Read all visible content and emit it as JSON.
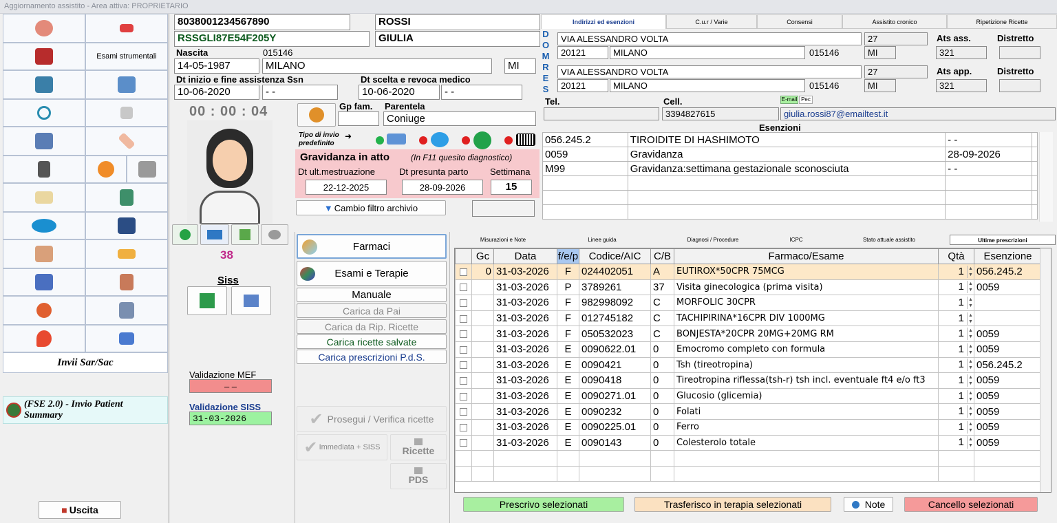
{
  "window_title": "Aggiornamento assistito - Area attiva: PROPRIETARIO",
  "patient": {
    "card_number": "8038001234567890",
    "fiscal_code": "RSSGLI87E54F205Y",
    "surname": "ROSSI",
    "name": "GIULIA",
    "birth_label": "Nascita",
    "birth_code": "015146",
    "birth_date": "14-05-1987",
    "birth_city": "MILANO",
    "birth_prov": "MI",
    "ssn_label": "Dt inizio e fine assistenza Ssn",
    "ssn_start": "10-06-2020",
    "ssn_end": "- -",
    "doctor_label": "Dt scelta e revoca medico",
    "doctor_start": "10-06-2020",
    "doctor_end": "- -",
    "timer": "00 : 00 : 04",
    "gp_label": "Gp fam.",
    "gp_value": "",
    "relation_label": "Parentela",
    "relation_value": "Coniuge",
    "count": "38",
    "siss_label": "Siss"
  },
  "send_type": {
    "label": "Tipo di invio predefinito",
    "arrow": "➜"
  },
  "pregnancy": {
    "title": "Gravidanza in atto",
    "note": "(In F11 quesito diagnostico)",
    "lmp_label": "Dt ult.mestruazione",
    "lmp": "22-12-2025",
    "due_label": "Dt presunta parto",
    "due": "28-09-2026",
    "week_label": "Settimana",
    "week": "15"
  },
  "filter_button": "Cambio filtro archivio",
  "validation": {
    "mef_label": "Validazione MEF",
    "mef_value": "–   –",
    "siss_label": "Validazione SISS",
    "siss_value": "31-03-2026"
  },
  "nav": {
    "esami_label": "Esami strumentali",
    "invii_label": "Invii Sar/Sac",
    "fse_label": "(FSE 2.0) - Invio Patient Summary",
    "exit_label": "Uscita"
  },
  "top_tabs": [
    "Indirizzi ed esenzioni",
    "C.u.r / Varie",
    "Consensi",
    "Assistito cronico",
    "Ripetizione Ricette"
  ],
  "address": {
    "dom_letters": [
      "D",
      "O",
      "M"
    ],
    "res_letters": [
      "R",
      "E",
      "S"
    ],
    "dom_street": "VIA ALESSANDRO VOLTA",
    "dom_number": "27",
    "dom_cap": "20121",
    "dom_city": "MILANO",
    "dom_code": "015146",
    "dom_prov": "MI",
    "ats_ass_label": "Ats ass.",
    "ats_ass": "321",
    "distretto_label": "Distretto",
    "res_street": "VIA ALESSANDRO VOLTA",
    "res_number": "27",
    "res_cap": "20121",
    "res_city": "MILANO",
    "res_code": "015146",
    "res_prov": "MI",
    "ats_app_label": "Ats app.",
    "ats_app": "321",
    "tel_label": "Tel.",
    "tel": "",
    "cell_label": "Cell.",
    "cell": "3394827615",
    "email_tag": "E-mail",
    "pec_tag": "Pec",
    "email": "giulia.rossi87@emailtest.it"
  },
  "exemptions": {
    "title": "Esenzioni",
    "rows": [
      {
        "code": "056.245.2",
        "desc": "TIROIDITE DI HASHIMOTO",
        "date": "- -"
      },
      {
        "code": "0059",
        "desc": "Gravidanza",
        "date": "28-09-2026"
      },
      {
        "code": "M99",
        "desc": "Gravidanza:settimana gestazionale sconosciuta",
        "date": "- -"
      }
    ]
  },
  "mid_buttons": {
    "farmaci": "Farmaci",
    "esami": "Esami e Terapie",
    "manuale": "Manuale",
    "carica_pai": "Carica da Pai",
    "carica_rip": "Carica da Rip. Ricette",
    "carica_salvate": "Carica ricette salvate",
    "carica_pds": "Carica prescrizioni P.d.S.",
    "prosegui": "Prosegui / Verifica ricette",
    "immediata": "Immediata + SISS",
    "ricette": "Ricette",
    "pds": "PDS"
  },
  "lower_tabs": [
    "Misurazioni e Note",
    "Linee guida",
    "Diagnosi / Procedure",
    "ICPC",
    "Stato attuale assistito",
    "Ultime prescrizioni"
  ],
  "prescriptions": {
    "headers": [
      "",
      "Gc",
      "Data",
      "f/e/p",
      "Codice/AIC",
      "C/B",
      "Farmaco/Esame",
      "Qtà",
      "Esenzione"
    ],
    "rows": [
      {
        "gc": "0",
        "date": "31-03-2026",
        "type": "F",
        "code": "024402051",
        "cb": "A",
        "name": "EUTIROX*50CPR 75MCG",
        "qty": "1",
        "ex": "056.245.2"
      },
      {
        "gc": "",
        "date": "31-03-2026",
        "type": "P",
        "code": "3789261",
        "cb": "37",
        "name": "Visita ginecologica (prima visita)",
        "qty": "1",
        "ex": "0059"
      },
      {
        "gc": "",
        "date": "31-03-2026",
        "type": "F",
        "code": "982998092",
        "cb": "C",
        "name": "MORFOLIC 30CPR",
        "qty": "1",
        "ex": ""
      },
      {
        "gc": "",
        "date": "31-03-2026",
        "type": "F",
        "code": "012745182",
        "cb": "C",
        "name": "TACHIPIRINA*16CPR DIV 1000MG",
        "qty": "1",
        "ex": ""
      },
      {
        "gc": "",
        "date": "31-03-2026",
        "type": "F",
        "code": "050532023",
        "cb": "C",
        "name": "BONJESTA*20CPR 20MG+20MG RM",
        "qty": "1",
        "ex": "0059"
      },
      {
        "gc": "",
        "date": "31-03-2026",
        "type": "E",
        "code": "0090622.01",
        "cb": "0",
        "name": "Emocromo completo con formula",
        "qty": "1",
        "ex": "0059"
      },
      {
        "gc": "",
        "date": "31-03-2026",
        "type": "E",
        "code": "0090421",
        "cb": "0",
        "name": "Tsh (tireotropina)",
        "qty": "1",
        "ex": "056.245.2"
      },
      {
        "gc": "",
        "date": "31-03-2026",
        "type": "E",
        "code": "0090418",
        "cb": "0",
        "name": "Tireotropina riflessa(tsh-r) tsh incl. eventuale ft4 e/o ft3",
        "qty": "1",
        "ex": "0059"
      },
      {
        "gc": "",
        "date": "31-03-2026",
        "type": "E",
        "code": "0090271.01",
        "cb": "0",
        "name": "Glucosio (glicemia)",
        "qty": "1",
        "ex": "0059"
      },
      {
        "gc": "",
        "date": "31-03-2026",
        "type": "E",
        "code": "0090232",
        "cb": "0",
        "name": "Folati",
        "qty": "1",
        "ex": "0059"
      },
      {
        "gc": "",
        "date": "31-03-2026",
        "type": "E",
        "code": "0090225.01",
        "cb": "0",
        "name": "Ferro",
        "qty": "1",
        "ex": "0059"
      },
      {
        "gc": "",
        "date": "31-03-2026",
        "type": "E",
        "code": "0090143",
        "cb": "0",
        "name": "Colesterolo totale",
        "qty": "1",
        "ex": "0059"
      }
    ]
  },
  "actions": {
    "prescrivo": "Prescrivo selezionati",
    "trasferisco": "Trasferisco in terapia selezionati",
    "note": "Note",
    "cancello": "Cancello selezionati"
  },
  "colors": {
    "pregnancy_bg": "#f7c9cd",
    "highlight_row": "#fde8c8",
    "green_btn": "#a8efa0",
    "peach_btn": "#fbe1c1",
    "red_btn": "#f59a9a",
    "accent_blue": "#1a3d8f"
  }
}
